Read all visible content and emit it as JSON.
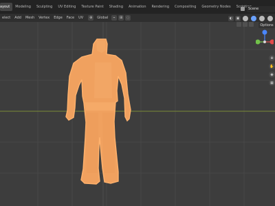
{
  "topbar": {
    "tabs": [
      {
        "label": "ayout",
        "active": true
      },
      {
        "label": "Modeling",
        "active": false
      },
      {
        "label": "Sculpting",
        "active": false
      },
      {
        "label": "UV Editing",
        "active": false
      },
      {
        "label": "Texture Paint",
        "active": false
      },
      {
        "label": "Shading",
        "active": false
      },
      {
        "label": "Animation",
        "active": false
      },
      {
        "label": "Rendering",
        "active": false
      },
      {
        "label": "Compositing",
        "active": false
      },
      {
        "label": "Geometry Nodes",
        "active": false
      },
      {
        "label": "Scripting",
        "active": false
      }
    ],
    "scene": "Scene"
  },
  "header": {
    "menus": [
      "elect",
      "Add",
      "Mesh",
      "Vertex",
      "Edge",
      "Face",
      "UV"
    ],
    "transform_orientation": "Global"
  },
  "viewport": {
    "options_label": "Options",
    "gizmo": {
      "labels": [
        "Z",
        "Y",
        "X"
      ]
    },
    "colors": {
      "background": "#3d3d3d",
      "grid_major": "#4a4a4a",
      "x_axis": "#8c3b3b",
      "y_axis": "#6d8a33",
      "mesh_fill": "#f0a15f",
      "mesh_edge": "#ffb26d"
    }
  }
}
